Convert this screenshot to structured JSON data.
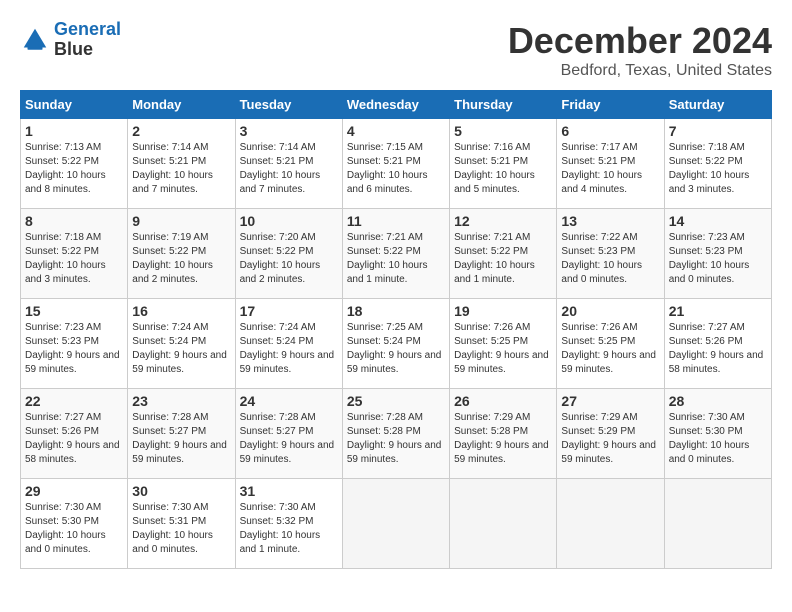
{
  "header": {
    "logo_line1": "General",
    "logo_line2": "Blue",
    "month": "December 2024",
    "location": "Bedford, Texas, United States"
  },
  "weekdays": [
    "Sunday",
    "Monday",
    "Tuesday",
    "Wednesday",
    "Thursday",
    "Friday",
    "Saturday"
  ],
  "weeks": [
    [
      {
        "day": "1",
        "sunrise": "7:13 AM",
        "sunset": "5:22 PM",
        "daylight": "10 hours and 8 minutes."
      },
      {
        "day": "2",
        "sunrise": "7:14 AM",
        "sunset": "5:21 PM",
        "daylight": "10 hours and 7 minutes."
      },
      {
        "day": "3",
        "sunrise": "7:14 AM",
        "sunset": "5:21 PM",
        "daylight": "10 hours and 7 minutes."
      },
      {
        "day": "4",
        "sunrise": "7:15 AM",
        "sunset": "5:21 PM",
        "daylight": "10 hours and 6 minutes."
      },
      {
        "day": "5",
        "sunrise": "7:16 AM",
        "sunset": "5:21 PM",
        "daylight": "10 hours and 5 minutes."
      },
      {
        "day": "6",
        "sunrise": "7:17 AM",
        "sunset": "5:21 PM",
        "daylight": "10 hours and 4 minutes."
      },
      {
        "day": "7",
        "sunrise": "7:18 AM",
        "sunset": "5:22 PM",
        "daylight": "10 hours and 3 minutes."
      }
    ],
    [
      {
        "day": "8",
        "sunrise": "7:18 AM",
        "sunset": "5:22 PM",
        "daylight": "10 hours and 3 minutes."
      },
      {
        "day": "9",
        "sunrise": "7:19 AM",
        "sunset": "5:22 PM",
        "daylight": "10 hours and 2 minutes."
      },
      {
        "day": "10",
        "sunrise": "7:20 AM",
        "sunset": "5:22 PM",
        "daylight": "10 hours and 2 minutes."
      },
      {
        "day": "11",
        "sunrise": "7:21 AM",
        "sunset": "5:22 PM",
        "daylight": "10 hours and 1 minute."
      },
      {
        "day": "12",
        "sunrise": "7:21 AM",
        "sunset": "5:22 PM",
        "daylight": "10 hours and 1 minute."
      },
      {
        "day": "13",
        "sunrise": "7:22 AM",
        "sunset": "5:23 PM",
        "daylight": "10 hours and 0 minutes."
      },
      {
        "day": "14",
        "sunrise": "7:23 AM",
        "sunset": "5:23 PM",
        "daylight": "10 hours and 0 minutes."
      }
    ],
    [
      {
        "day": "15",
        "sunrise": "7:23 AM",
        "sunset": "5:23 PM",
        "daylight": "9 hours and 59 minutes."
      },
      {
        "day": "16",
        "sunrise": "7:24 AM",
        "sunset": "5:24 PM",
        "daylight": "9 hours and 59 minutes."
      },
      {
        "day": "17",
        "sunrise": "7:24 AM",
        "sunset": "5:24 PM",
        "daylight": "9 hours and 59 minutes."
      },
      {
        "day": "18",
        "sunrise": "7:25 AM",
        "sunset": "5:24 PM",
        "daylight": "9 hours and 59 minutes."
      },
      {
        "day": "19",
        "sunrise": "7:26 AM",
        "sunset": "5:25 PM",
        "daylight": "9 hours and 59 minutes."
      },
      {
        "day": "20",
        "sunrise": "7:26 AM",
        "sunset": "5:25 PM",
        "daylight": "9 hours and 59 minutes."
      },
      {
        "day": "21",
        "sunrise": "7:27 AM",
        "sunset": "5:26 PM",
        "daylight": "9 hours and 58 minutes."
      }
    ],
    [
      {
        "day": "22",
        "sunrise": "7:27 AM",
        "sunset": "5:26 PM",
        "daylight": "9 hours and 58 minutes."
      },
      {
        "day": "23",
        "sunrise": "7:28 AM",
        "sunset": "5:27 PM",
        "daylight": "9 hours and 59 minutes."
      },
      {
        "day": "24",
        "sunrise": "7:28 AM",
        "sunset": "5:27 PM",
        "daylight": "9 hours and 59 minutes."
      },
      {
        "day": "25",
        "sunrise": "7:28 AM",
        "sunset": "5:28 PM",
        "daylight": "9 hours and 59 minutes."
      },
      {
        "day": "26",
        "sunrise": "7:29 AM",
        "sunset": "5:28 PM",
        "daylight": "9 hours and 59 minutes."
      },
      {
        "day": "27",
        "sunrise": "7:29 AM",
        "sunset": "5:29 PM",
        "daylight": "9 hours and 59 minutes."
      },
      {
        "day": "28",
        "sunrise": "7:30 AM",
        "sunset": "5:30 PM",
        "daylight": "10 hours and 0 minutes."
      }
    ],
    [
      {
        "day": "29",
        "sunrise": "7:30 AM",
        "sunset": "5:30 PM",
        "daylight": "10 hours and 0 minutes."
      },
      {
        "day": "30",
        "sunrise": "7:30 AM",
        "sunset": "5:31 PM",
        "daylight": "10 hours and 0 minutes."
      },
      {
        "day": "31",
        "sunrise": "7:30 AM",
        "sunset": "5:32 PM",
        "daylight": "10 hours and 1 minute."
      },
      null,
      null,
      null,
      null
    ]
  ],
  "labels": {
    "sunrise": "Sunrise:",
    "sunset": "Sunset:",
    "daylight": "Daylight:"
  }
}
